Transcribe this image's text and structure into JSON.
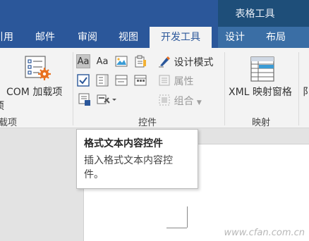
{
  "title_bar": {
    "context_header": "表格工具"
  },
  "tabs": [
    {
      "label": "引用"
    },
    {
      "label": "邮件"
    },
    {
      "label": "审阅"
    },
    {
      "label": "视图"
    },
    {
      "label": "开发工具",
      "active": true
    },
    {
      "label": "设计"
    },
    {
      "label": "布局"
    }
  ],
  "addins_group": {
    "com_button_label_line1": "COM 加载项",
    "com_button_label_line2_partial": "项",
    "label_partial": "载项"
  },
  "controls_group": {
    "label": "控件",
    "design_mode": "设计模式",
    "properties": "属性",
    "group": "组合",
    "rich_text_control_glyph": "Aa",
    "plain_text_control_glyph": "Aa"
  },
  "mapping_group": {
    "label": "映射",
    "xml_mapping_pane": "XML 映射窗格"
  },
  "partial_right_label": "阝",
  "tooltip": {
    "title": "格式文本内容控件",
    "description": "插入格式文本内容控件。"
  },
  "watermark": "www.cfan.com.cn",
  "colors": {
    "ribbon_blue": "#2b579a",
    "context_header": "#1e4e79",
    "ribbon_bg": "#f3f3f3"
  }
}
